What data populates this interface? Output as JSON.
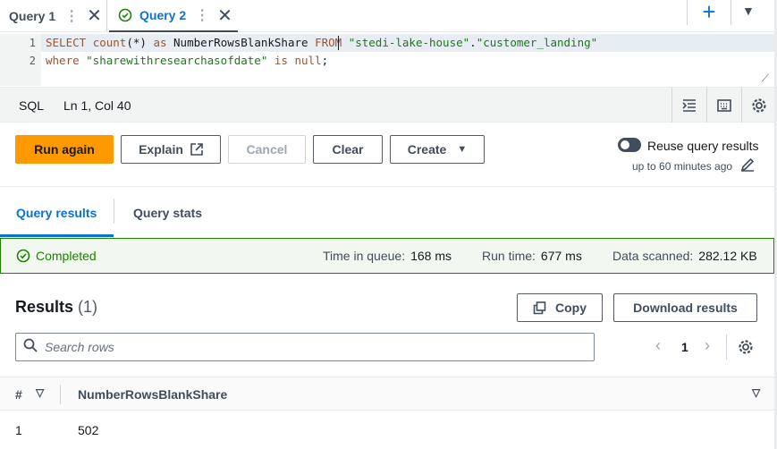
{
  "tabs": [
    {
      "label": "Query 1",
      "active": false
    },
    {
      "label": "Query 2",
      "active": true
    }
  ],
  "editor": {
    "lines": [
      {
        "number": "1",
        "parts": [
          {
            "text": "SELECT ",
            "kind": "kw"
          },
          {
            "text": "count",
            "kind": "kw"
          },
          {
            "text": "(*) ",
            "kind": "plain"
          },
          {
            "text": "as ",
            "kind": "kw"
          },
          {
            "text": "NumberRowsBlankShare ",
            "kind": "plain"
          },
          {
            "text": "FROM ",
            "kind": "kw"
          },
          {
            "text": "\"stedi-lake-house\"",
            "kind": "str"
          },
          {
            "text": ".",
            "kind": "plain"
          },
          {
            "text": "\"customer_landing\"",
            "kind": "str"
          }
        ]
      },
      {
        "number": "2",
        "parts": [
          {
            "text": "where ",
            "kind": "kw"
          },
          {
            "text": "\"sharewithresearchasofdate\"",
            "kind": "str"
          },
          {
            "text": " is ",
            "kind": "kw"
          },
          {
            "text": "null",
            "kind": "kw"
          },
          {
            "text": ";",
            "kind": "plain"
          }
        ]
      }
    ]
  },
  "statusbar": {
    "language": "SQL",
    "cursor": "Ln 1, Col 40"
  },
  "actions": {
    "run_again": "Run again",
    "explain": "Explain",
    "cancel": "Cancel",
    "clear": "Clear",
    "create": "Create",
    "reuse_label": "Reuse query results",
    "reuse_sub": "up to 60 minutes ago"
  },
  "result_tabs": {
    "results": "Query results",
    "stats": "Query stats"
  },
  "status": {
    "state": "Completed",
    "time_in_queue_label": "Time in queue:",
    "time_in_queue": "168 ms",
    "run_time_label": "Run time:",
    "run_time": "677 ms",
    "data_scanned_label": "Data scanned:",
    "data_scanned": "282.12 KB"
  },
  "results": {
    "title": "Results",
    "count": "(1)",
    "copy": "Copy",
    "download": "Download results",
    "search_placeholder": "Search rows",
    "page": "1",
    "columns": {
      "index": "#",
      "col1": "NumberRowsBlankShare"
    },
    "rows": [
      {
        "index": "1",
        "value": "502"
      }
    ]
  },
  "colors": {
    "accent": "#0972d3",
    "primary_button": "#ff9900",
    "success": "#1d8102"
  },
  "icons": [
    "close-icon",
    "vertical-dots-icon",
    "check-circle-icon",
    "plus-icon",
    "caret-down-icon",
    "format-icon",
    "keyboard-icon",
    "settings-icon",
    "external-link-icon",
    "pencil-icon",
    "copy-icon",
    "search-icon",
    "chevron-left-icon",
    "chevron-right-icon",
    "sort-icon"
  ]
}
